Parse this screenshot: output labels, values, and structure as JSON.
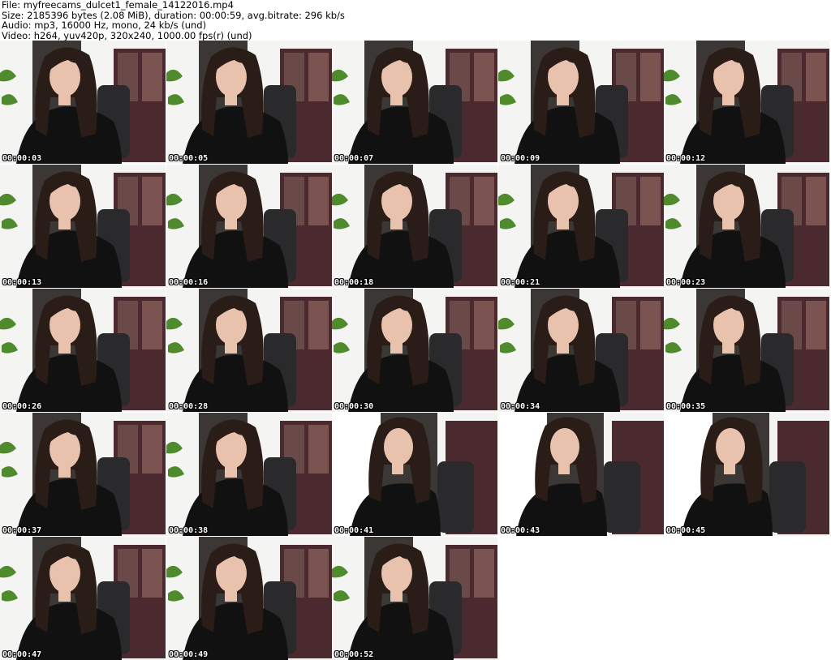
{
  "header": {
    "file_line": "File: myfreecams_dulcet1_female_14122016.mp4",
    "size_line": "Size: 2185396 bytes (2.08 MiB), duration: 00:00:59, avg.bitrate: 296 kb/s",
    "audio_line": "Audio: mp3, 16000 Hz, mono, 24 kb/s (und)",
    "video_line": "Video: h264, yuv420p, 320x240, 1000.00 fps(r) (und)"
  },
  "thumbnails": [
    {
      "timestamp": "00:00:03",
      "variant": "a"
    },
    {
      "timestamp": "00:00:05",
      "variant": "a"
    },
    {
      "timestamp": "00:00:07",
      "variant": "a"
    },
    {
      "timestamp": "00:00:09",
      "variant": "a"
    },
    {
      "timestamp": "00:00:12",
      "variant": "a"
    },
    {
      "timestamp": "00:00:13",
      "variant": "a"
    },
    {
      "timestamp": "00:00:16",
      "variant": "a"
    },
    {
      "timestamp": "00:00:18",
      "variant": "a"
    },
    {
      "timestamp": "00:00:21",
      "variant": "a"
    },
    {
      "timestamp": "00:00:23",
      "variant": "a"
    },
    {
      "timestamp": "00:00:26",
      "variant": "a"
    },
    {
      "timestamp": "00:00:28",
      "variant": "a"
    },
    {
      "timestamp": "00:00:30",
      "variant": "a"
    },
    {
      "timestamp": "00:00:34",
      "variant": "a"
    },
    {
      "timestamp": "00:00:35",
      "variant": "a"
    },
    {
      "timestamp": "00:00:37",
      "variant": "a"
    },
    {
      "timestamp": "00:00:38",
      "variant": "a"
    },
    {
      "timestamp": "00:00:41",
      "variant": "b"
    },
    {
      "timestamp": "00:00:43",
      "variant": "b"
    },
    {
      "timestamp": "00:00:45",
      "variant": "b"
    },
    {
      "timestamp": "00:00:47",
      "variant": "a"
    },
    {
      "timestamp": "00:00:49",
      "variant": "a"
    },
    {
      "timestamp": "00:00:52",
      "variant": "a"
    }
  ],
  "colors": {
    "wall": "#f4f4f2",
    "shirt": "#111111",
    "hair": "#2a1d17",
    "skin": "#e9c2ad",
    "chair": "#2a2a2c",
    "cabinet": "#4a2a2e",
    "plant": "#4f8a2c",
    "door": "#3b3735"
  }
}
